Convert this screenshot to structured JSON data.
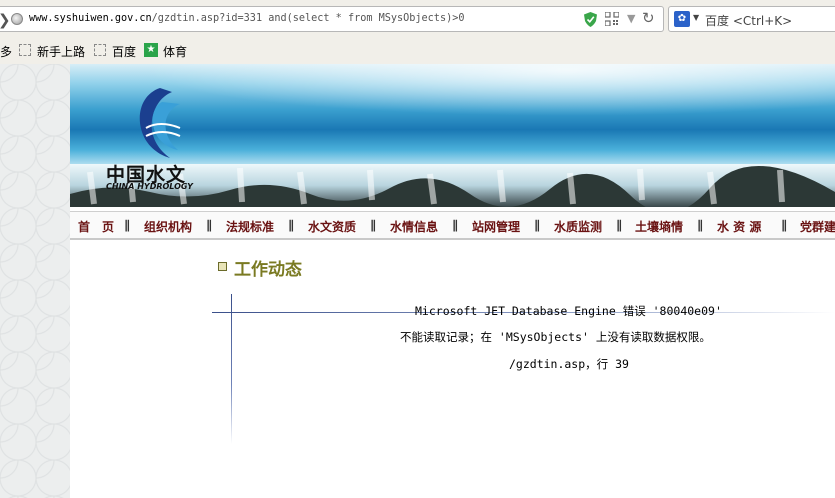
{
  "browser": {
    "url_host": "www.syshuiwen.gov.cn",
    "url_rest": "/gzdtin.asp?id=331 and(select * from MSysObjects)>0",
    "search_engine": "百度",
    "search_shortcut": "<Ctrl+K>",
    "bookmarks": [
      {
        "label": "多",
        "icon": "folder-icon"
      },
      {
        "label": "新手上路",
        "icon": "dashed-page-icon"
      },
      {
        "label": "百度",
        "icon": "dashed-page-icon"
      },
      {
        "label": "体育",
        "icon": "sport-icon"
      }
    ]
  },
  "site": {
    "logo_cn": "中国水文",
    "logo_en": "CHINA HYDROLOGY"
  },
  "nav": {
    "items": [
      "首　页",
      "组织机构",
      "法规标准",
      "水文资质",
      "水情信息",
      "站网管理",
      "水质监测",
      "土壤墒情",
      "水 资 源",
      "党群建"
    ],
    "separator": "∥"
  },
  "section": {
    "title": "工作动态"
  },
  "error": {
    "line1": "Microsoft JET Database Engine 错误 '80040e09'",
    "line2": "不能读取记录；在 'MSysObjects' 上没有读取数据权限。",
    "line3": "/gzdtin.asp，行 39"
  },
  "colors": {
    "nav_text": "#6a1212",
    "section_title": "#7a7a22",
    "rule": "#3a4f8a"
  }
}
